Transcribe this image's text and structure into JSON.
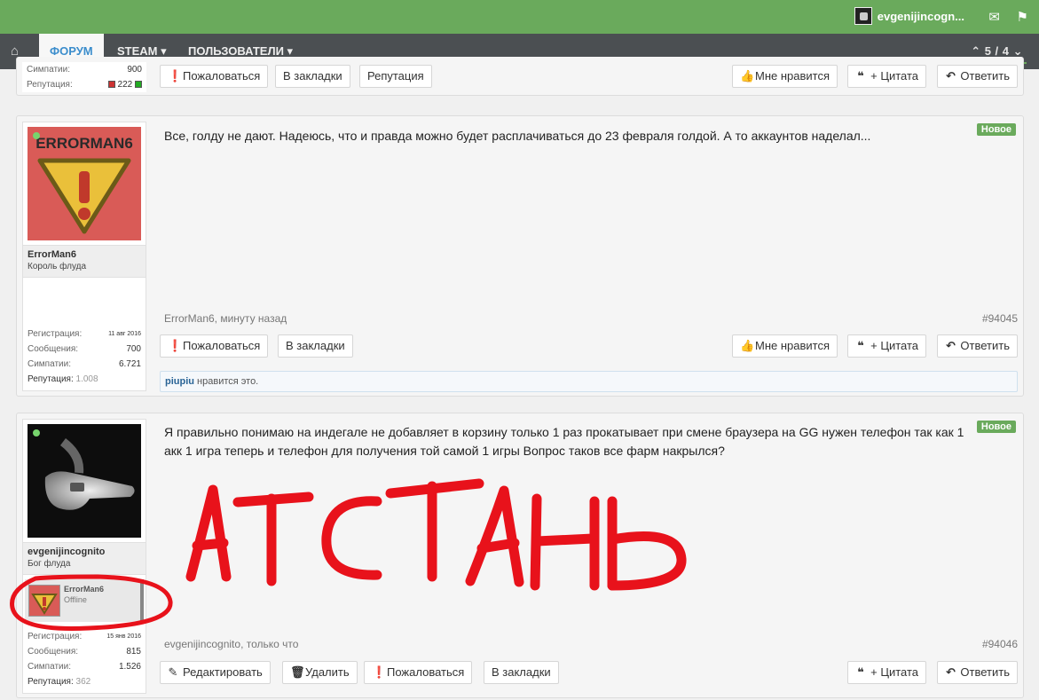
{
  "topbar": {
    "username": "evgenijincogn..."
  },
  "nav": {
    "tabs": [
      "ФОРУМ",
      "STEAM ▾",
      "ПОЛЬЗОВАТЕЛИ ▾"
    ],
    "pager": "⌃ 5 / 4 ⌄"
  },
  "post0": {
    "stats": [
      {
        "label": "Симпатии:",
        "value": "900"
      },
      {
        "label": "Репутация:",
        "value": "222"
      }
    ],
    "buttons_left": [
      "Пожаловаться",
      "В закладки",
      "Репутация"
    ],
    "buttons_right": [
      "Мне нравится",
      "+ Цитата",
      "Ответить"
    ]
  },
  "post1": {
    "avatar_text": "ERRORMAN6",
    "username": "ErrorMan6",
    "user_title": "Король флуда",
    "stats": [
      {
        "label": "Регистрация:",
        "value": "11 авг 2016"
      },
      {
        "label": "Сообщения:",
        "value": "700"
      },
      {
        "label": "Симпатии:",
        "value": "6.721"
      },
      {
        "label": "Репутация:",
        "value": "1.008"
      }
    ],
    "message": "Все, голду не дают. Надеюсь, что и правда можно будет расплачиваться до 23 февраля голдой. А то аккаунтов наделал...",
    "badge": "Новое",
    "meta": "ErrorMan6, минуту назад",
    "post_id": "#94045",
    "buttons_left": [
      "Пожаловаться",
      "В закладки"
    ],
    "buttons_right": [
      "Мне нравится",
      "+ Цитата",
      "Ответить"
    ],
    "likes_user": "piupiu",
    "likes_text": " нравится это."
  },
  "post2": {
    "username": "evgenijincognito",
    "user_title": "Бог флуда",
    "popup": {
      "name": "ErrorMan6",
      "status": "Offline"
    },
    "stats": [
      {
        "label": "Регистрация:",
        "value": "15 янв 2016"
      },
      {
        "label": "Сообщения:",
        "value": "815"
      },
      {
        "label": "Симпатии:",
        "value": "1.526"
      },
      {
        "label": "Репутация:",
        "value": "362"
      }
    ],
    "message": "Я правильно понимаю на индегале не добавляет в корзину только 1 раз прокатывает при смене браузера на GG нужен телефон так как 1 акк 1 игра теперь и телефон для получения той самой 1 игры Вопрос таков все фарм накрылся?",
    "badge": "Новое",
    "meta": "evgenijincognito, только что",
    "post_id": "#94046",
    "buttons_left": [
      "Редактировать",
      "Удалить",
      "Пожаловаться",
      "В закладки"
    ],
    "buttons_right": [
      "+ Цитата",
      "Ответить"
    ]
  },
  "handwriting": "АТСТАНЬ",
  "colors": {
    "accent": "#6aaa5c",
    "nav": "#4b4f52",
    "scribble": "#e8121b"
  }
}
